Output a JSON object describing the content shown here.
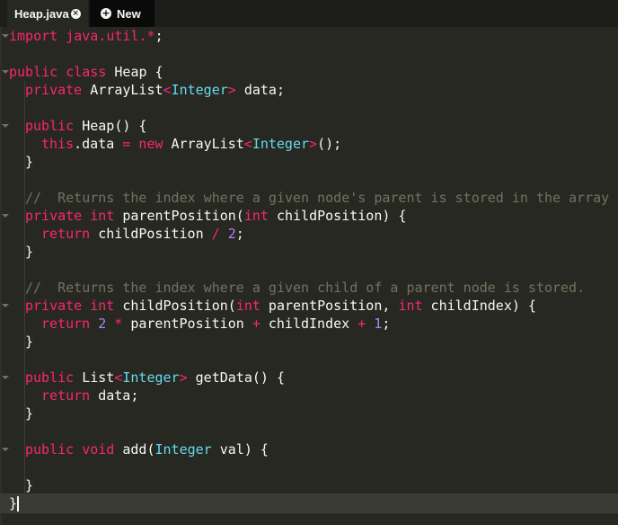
{
  "tabs": {
    "active_label": "Heap.java",
    "close_glyph": "×",
    "new_label": "New",
    "new_glyph": "+"
  },
  "code": {
    "l1": {
      "a": "import java.util.",
      "b": "*",
      "c": ";"
    },
    "l3": {
      "a": "public class",
      "b": " Heap {"
    },
    "l4": {
      "a": "private",
      "b": " ArrayList",
      "c": "<",
      "d": "Integer",
      "e": ">",
      "f": " data;"
    },
    "l6": {
      "a": "public",
      "b": " Heap() {"
    },
    "l7": {
      "a": "this",
      "b": ".data ",
      "c": "=",
      "d": " ",
      "e": "new",
      "f": " ArrayList",
      "g": "<",
      "h": "Integer",
      "i": ">",
      "j": "();"
    },
    "l8": "}",
    "l10": "//  Returns the index where a given node's parent is stored in the array",
    "l11": {
      "a": "private int",
      "b": " parentPosition(",
      "c": "int",
      "d": " childPosition) {"
    },
    "l12": {
      "a": "return",
      "b": " childPosition ",
      "c": "/",
      "d": " ",
      "e": "2",
      "f": ";"
    },
    "l13": "}",
    "l15": "//  Returns the index where a given child of a parent node is stored.",
    "l16": {
      "a": "private int",
      "b": " childPosition(",
      "c": "int",
      "d": " parentPosition, ",
      "e": "int",
      "f": " childIndex) {"
    },
    "l17": {
      "a": "return",
      "b": " ",
      "c": "2",
      "d": " ",
      "e": "*",
      "f": " parentPosition ",
      "g": "+",
      "h": " childIndex ",
      "i": "+",
      "j": " ",
      "k": "1",
      "l": ";"
    },
    "l18": "}",
    "l20": {
      "a": "public",
      "b": " List",
      "c": "<",
      "d": "Integer",
      "e": ">",
      "f": " getData() {"
    },
    "l21": {
      "a": "return",
      "b": " data;"
    },
    "l22": "}",
    "l24": {
      "a": "public void",
      "b": " add(",
      "c": "Integer",
      "d": " val) {"
    },
    "l26": "}",
    "l27": "}"
  },
  "colors": {
    "background": "#272822",
    "keyword": "#f92672",
    "type": "#66d9ef",
    "number": "#ae81ff",
    "comment": "#75715e",
    "text": "#f8f8f2"
  }
}
